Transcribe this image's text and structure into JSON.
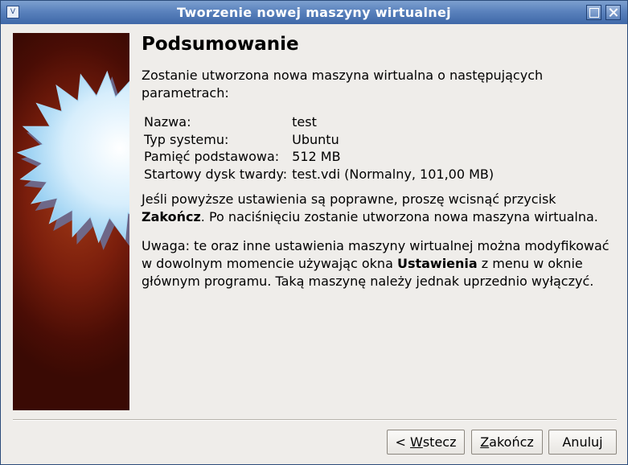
{
  "window": {
    "title": "Tworzenie nowej maszyny wirtualnej"
  },
  "heading": "Podsumowanie",
  "intro": "Zostanie utworzona nowa maszyna wirtualna o następujących parametrach:",
  "summary": [
    {
      "label": "Nazwa:",
      "value": "test"
    },
    {
      "label": "Typ systemu:",
      "value": "Ubuntu"
    },
    {
      "label": "Pamięć podstawowa:",
      "value": "512 MB"
    },
    {
      "label": "Startowy dysk twardy:",
      "value": "test.vdi (Normalny, 101,00 MB)"
    }
  ],
  "confirm": {
    "before": "Jeśli powyższe ustawienia są poprawne, proszę wcisnąć przycisk ",
    "bold": "Zakończ",
    "after": ". Po naciśnięciu zostanie utworzona nowa maszyna wirtualna."
  },
  "note": {
    "before": "Uwaga: te oraz inne ustawienia maszyny wirtualnej można modyfikować w dowolnym momencie używając okna ",
    "bold": "Ustawienia",
    "after": " z menu w oknie głównym programu. Taką maszynę należy jednak uprzednio wyłączyć."
  },
  "buttons": {
    "back_prefix": "< ",
    "back_mnemonic": "W",
    "back_rest": "stecz",
    "finish_mnemonic": "Z",
    "finish_rest": "akończ",
    "cancel": "Anuluj"
  },
  "icons": {
    "app": "virtualbox-icon",
    "maximize": "maximize-icon",
    "close": "close-icon",
    "star": "star-burst-icon"
  }
}
